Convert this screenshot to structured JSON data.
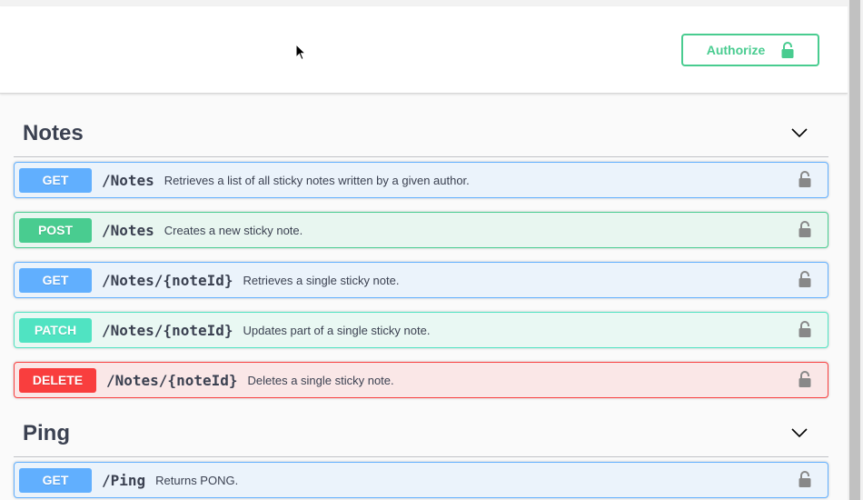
{
  "header": {
    "authorize_label": "Authorize"
  },
  "tags": [
    {
      "name": "Notes"
    },
    {
      "name": "Ping"
    }
  ],
  "operations": [
    {
      "method": "GET",
      "path": "/Notes",
      "summary": "Retrieves a list of all sticky notes written by a given author."
    },
    {
      "method": "POST",
      "path": "/Notes",
      "summary": "Creates a new sticky note."
    },
    {
      "method": "GET",
      "path": "/Notes/{noteId}",
      "summary": "Retrieves a single sticky note."
    },
    {
      "method": "PATCH",
      "path": "/Notes/{noteId}",
      "summary": "Updates part of a single sticky note."
    },
    {
      "method": "DELETE",
      "path": "/Notes/{noteId}",
      "summary": "Deletes a single sticky note."
    },
    {
      "method": "GET",
      "path": "/Ping",
      "summary": "Returns PONG."
    }
  ],
  "icons": {
    "authorize": "unlocked-lock-icon",
    "operation_lock": "unlocked-lock-icon",
    "tag_toggle": "chevron-down-icon"
  },
  "colors": {
    "get": "#61affe",
    "post": "#49cc90",
    "patch": "#50e3c2",
    "delete": "#f93e3e",
    "text": "#3b4151"
  }
}
